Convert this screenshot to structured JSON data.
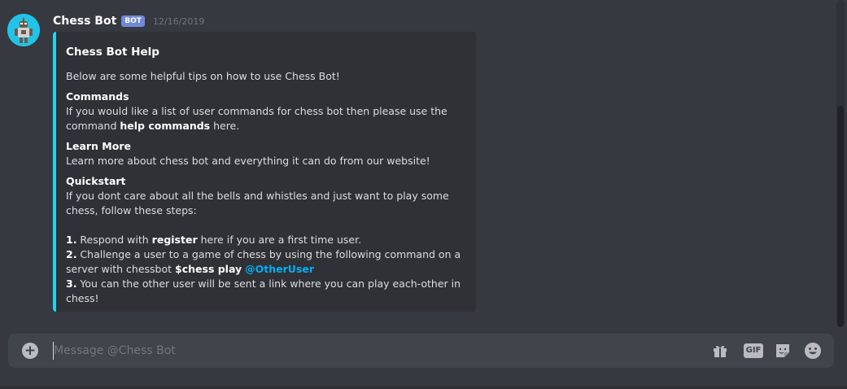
{
  "message": {
    "author": "Chess Bot",
    "badge": "BOT",
    "timestamp": "12/16/2019"
  },
  "embed": {
    "accent_color": "#22d3ee",
    "title": "Chess Bot Help",
    "description": "Below are some helpful tips on how to use Chess Bot!",
    "fields": [
      {
        "name": "Commands",
        "value_pre": "If you would like a list of user commands for chess bot then please use the command ",
        "value_bold": "help commands",
        "value_post": " here."
      },
      {
        "name": "Learn More",
        "value": "Learn more about chess bot and everything it can do from our website!"
      },
      {
        "name": "Quickstart",
        "intro": "If you dont care about all the bells and whistles and just want to play some chess, follow these steps:",
        "step1_num": "1.",
        "step1_pre": " Respond with ",
        "step1_bold": "register",
        "step1_post": " here if you are a first time user.",
        "step2_num": "2.",
        "step2_pre": " Challenge a user to a game of chess by using the following command on a server with chessbot ",
        "step2_cmd": "$chess play",
        "step2_mention": "@OtherUser",
        "step3_num": "3.",
        "step3_text": " You can the other user will be sent a link where you can play each-other in chess!"
      }
    ]
  },
  "composer": {
    "placeholder": "Message @Chess Bot",
    "gif_label": "GIF"
  },
  "icons": {
    "add": "plus-circle-icon",
    "gift": "gift-icon",
    "gif": "gif-icon",
    "sticker": "sticker-icon",
    "emoji": "emoji-icon"
  },
  "colors": {
    "background": "#36393f",
    "embed_bg": "#2f3136",
    "bot_badge": "#7289da",
    "mention": "#00b0f4",
    "composer_bg": "#40444b"
  }
}
